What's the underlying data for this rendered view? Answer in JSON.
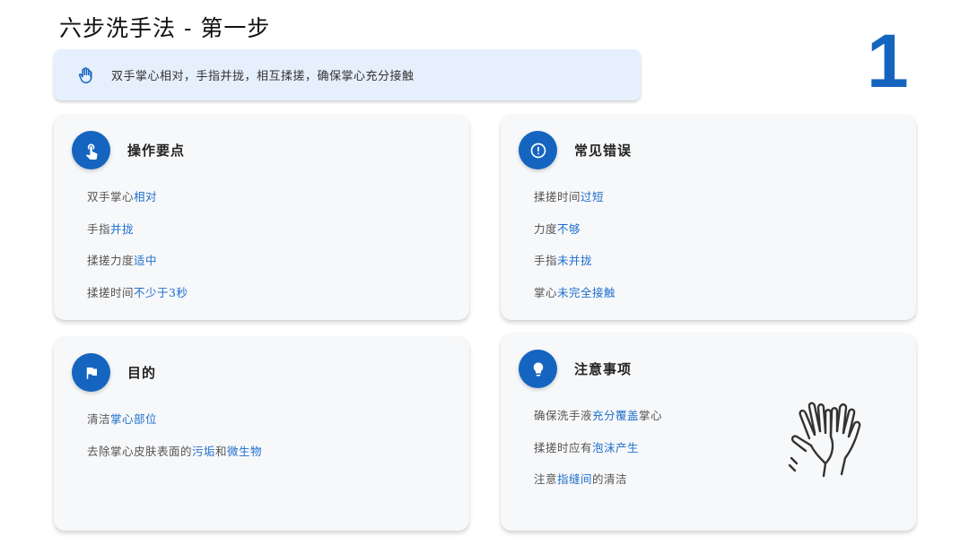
{
  "page": {
    "title": "六步洗手法 - 第一步",
    "step_number": "1",
    "summary": "双手掌心相对，手指并拢，相互揉搓，确保掌心充分接触"
  },
  "colors": {
    "accent": "#1565c0",
    "highlight": "#1e6fcc",
    "card_bg": "#f7f8fa",
    "summary_bg": "#e6effc"
  },
  "cards": {
    "key_points": {
      "icon": "pointing-hand-icon",
      "title": "操作要点",
      "items": [
        {
          "plain": "双手掌心",
          "hl": "相对",
          "tail": ""
        },
        {
          "plain": "手指",
          "hl": "并拢",
          "tail": ""
        },
        {
          "plain": "揉搓力度",
          "hl": "适中",
          "tail": ""
        },
        {
          "plain": "揉搓时间",
          "hl": "不少于3秒",
          "tail": ""
        }
      ]
    },
    "common_errors": {
      "icon": "exclamation-icon",
      "title": "常见错误",
      "items": [
        {
          "plain": "揉搓时间",
          "hl": "过短",
          "tail": ""
        },
        {
          "plain": "力度",
          "hl": "不够",
          "tail": ""
        },
        {
          "plain": "手指",
          "hl": "未并拢",
          "tail": ""
        },
        {
          "plain": "掌心",
          "hl": "未完全接触",
          "tail": ""
        }
      ]
    },
    "purpose": {
      "icon": "flag-icon",
      "title": "目的",
      "items": [
        {
          "plain": "清洁",
          "hl": "掌心部位",
          "mid": "",
          "hl2": "",
          "tail": ""
        },
        {
          "plain": "去除掌心皮肤表面的",
          "hl": "污垢",
          "mid": "和",
          "hl2": "微生物",
          "tail": ""
        }
      ]
    },
    "notes": {
      "icon": "lightbulb-icon",
      "title": "注意事项",
      "items": [
        {
          "plain": "确保洗手液",
          "hl": "充分覆盖",
          "tail": "掌心"
        },
        {
          "plain": "揉搓时应有",
          "hl": "泡沫产生",
          "tail": ""
        },
        {
          "plain": "注意",
          "hl": "指缝间",
          "tail": "的清洁"
        }
      ]
    }
  }
}
